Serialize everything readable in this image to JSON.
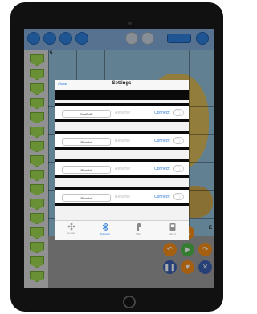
{
  "modal": {
    "close_label": "close",
    "title": "Settings",
    "devices": [
      {
        "name": "BlueBotE",
        "rename_label": "Rename",
        "connect_label": "Connect:"
      },
      {
        "name": "BlueBot",
        "rename_label": "Rename",
        "connect_label": "Connect:"
      },
      {
        "name": "BlueBot",
        "rename_label": "Rename",
        "connect_label": "Connect:"
      },
      {
        "name": "BlueBot",
        "rename_label": "Rename",
        "connect_label": "Connect:"
      }
    ],
    "tabs": [
      {
        "label": "Sounds",
        "icon": "sounds-icon",
        "active": false
      },
      {
        "label": "Bluetooth",
        "icon": "bluetooth-icon",
        "active": true
      },
      {
        "label": "Mats",
        "icon": "mats-icon",
        "active": false
      },
      {
        "label": "Mats 2",
        "icon": "mats2-icon",
        "active": false
      }
    ]
  },
  "map": {
    "markers": [
      "5",
      "E"
    ]
  },
  "colors": {
    "accent": "#2f7ed8",
    "go_button": "#4db848",
    "turn_button": "#f28c1a",
    "stop_button": "#3a5fb0",
    "program_slot": "#9bd44e"
  }
}
